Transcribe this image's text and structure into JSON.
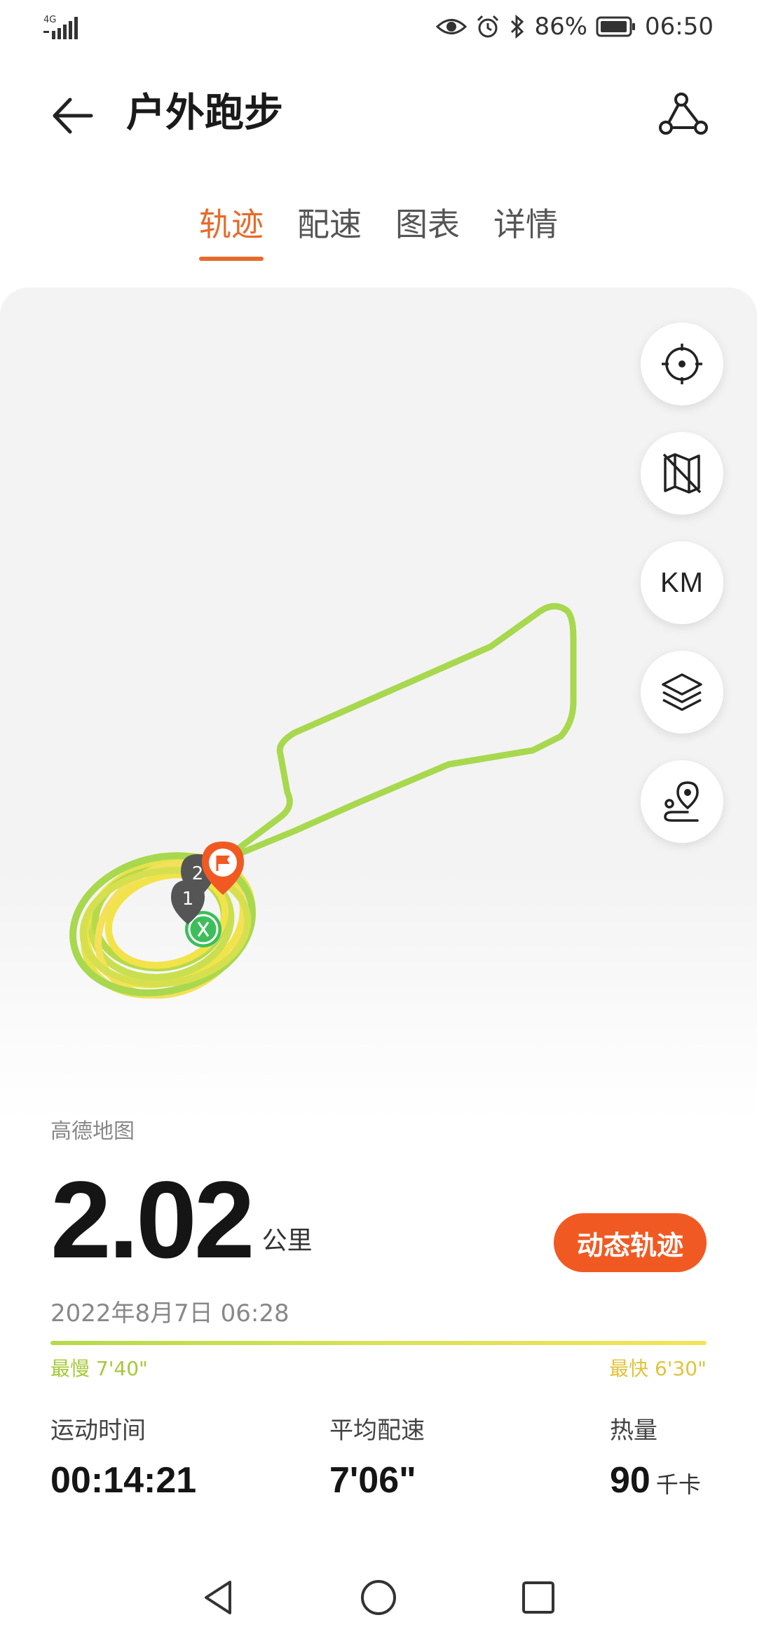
{
  "status_bar": {
    "network": "4G",
    "battery_text": "86%",
    "time": "06:50"
  },
  "header": {
    "title": "户外跑步"
  },
  "tabs": [
    {
      "label": "轨迹",
      "active": true
    },
    {
      "label": "配速",
      "active": false
    },
    {
      "label": "图表",
      "active": false
    },
    {
      "label": "详情",
      "active": false
    }
  ],
  "map": {
    "controls": {
      "locate_icon": "crosshair-icon",
      "map_type_icon": "map-off-icon",
      "km_label": "KM",
      "layers_icon": "layers-icon",
      "route_icon": "route-pin-icon"
    },
    "markers": {
      "lap_2": "2",
      "lap_1": "1"
    },
    "source": "高德地图"
  },
  "summary": {
    "distance_value": "2.02",
    "distance_unit": "公里",
    "dynamic_track_label": "动态轨迹",
    "datetime": "2022年8月7日 06:28",
    "pace_slow": "最慢 7'40\"",
    "pace_fast": "最快 6'30\""
  },
  "stats": [
    {
      "label": "运动时间",
      "value": "00:14:21",
      "unit": ""
    },
    {
      "label": "平均配速",
      "value": "7'06\"",
      "unit": ""
    },
    {
      "label": "热量",
      "value": "90",
      "unit": "千卡"
    }
  ],
  "colors": {
    "accent": "#e86a2b",
    "button": "#f05a22",
    "route_slow": "#a8d84e",
    "route_fast": "#f2e34a"
  }
}
